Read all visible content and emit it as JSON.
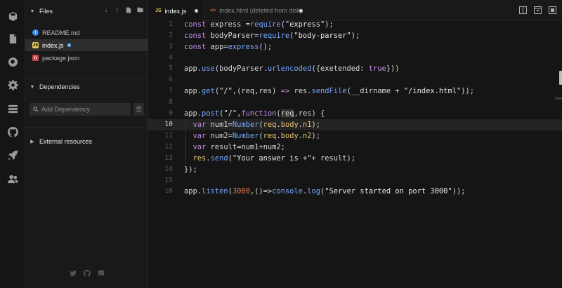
{
  "activity": {
    "icons": [
      "cube-icon",
      "file-icon",
      "search-icon",
      "gear-icon",
      "server-icon",
      "github-icon",
      "rocket-icon",
      "users-icon"
    ]
  },
  "sidebar": {
    "files_title": "Files",
    "files": [
      {
        "name": "README.md",
        "icon": "info-icon",
        "color": "#3b8ef0"
      },
      {
        "name": "index.js",
        "icon": "js-icon",
        "color": "#e8c85a",
        "active": true,
        "modified": true
      },
      {
        "name": "package.json",
        "icon": "npm-icon",
        "color": "#d64545"
      }
    ],
    "dependencies_title": "Dependencies",
    "dependency_placeholder": "Add Dependency",
    "external_title": "External resources"
  },
  "tabs": [
    {
      "type": "JS",
      "label": "index.js",
      "type_color": "#e8c85a",
      "active": true
    },
    {
      "type": "<>",
      "label": "index.html (deleted from disk)",
      "type_color": "#e2703a",
      "active": false
    }
  ],
  "editor": {
    "current_line": 10,
    "line_numbers": [
      "1",
      "2",
      "3",
      "4",
      "5",
      "6",
      "7",
      "8",
      "9",
      "10",
      "11",
      "12",
      "13",
      "14",
      "15",
      "16"
    ]
  },
  "colors": {
    "background": "#151515",
    "sidebar": "#191919",
    "keyword": "#c48ce7",
    "function": "#77a8ff",
    "number": "#e47b52"
  }
}
